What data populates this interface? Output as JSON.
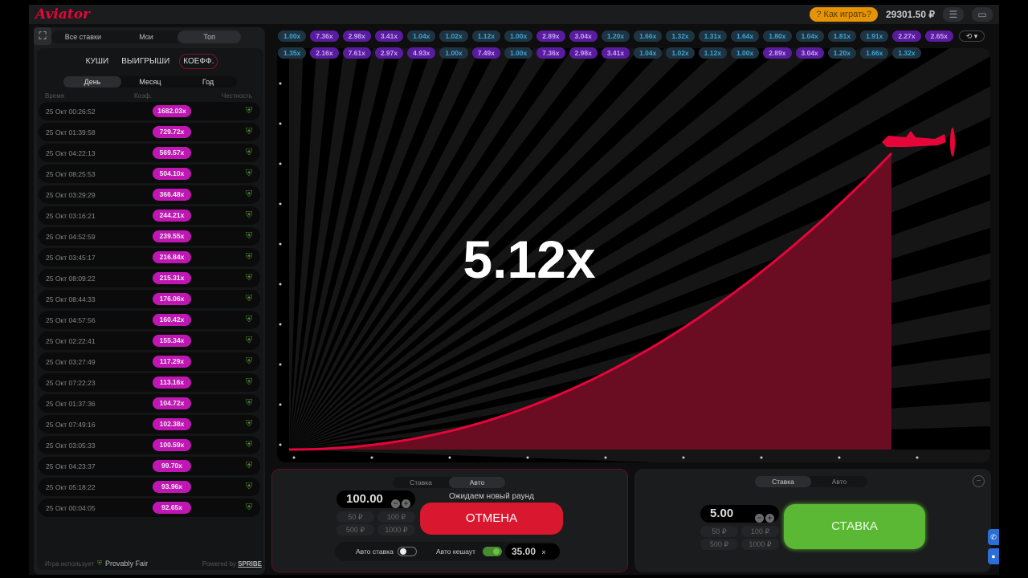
{
  "header": {
    "logo": "Aviator",
    "how_to_play": "Как играть?",
    "balance": "29301.50 ₽",
    "menu_icon": "☰",
    "chat_icon": "▭"
  },
  "left": {
    "tabs": [
      "Все ставки",
      "Мои",
      "Топ"
    ],
    "active_tab": "Топ",
    "categories": [
      "КУШИ",
      "ВЫИГРЫШИ",
      "КОЕФФ."
    ],
    "active_category": "КОЕФФ.",
    "periods": [
      "День",
      "Месяц",
      "Год"
    ],
    "active_period": "День",
    "columns": [
      "Время",
      "Коэф.",
      "Честность"
    ],
    "rows": [
      {
        "time": "25 Окт 00:26:52",
        "coef": "1682.03x"
      },
      {
        "time": "25 Окт 01:39:58",
        "coef": "729.72x"
      },
      {
        "time": "25 Окт 04:22:13",
        "coef": "569.57x"
      },
      {
        "time": "25 Окт 08:25:53",
        "coef": "504.10x"
      },
      {
        "time": "25 Окт 03:29:29",
        "coef": "366.48x"
      },
      {
        "time": "25 Окт 03:16:21",
        "coef": "244.21x"
      },
      {
        "time": "25 Окт 04:52:59",
        "coef": "239.55x"
      },
      {
        "time": "25 Окт 03:45:17",
        "coef": "216.84x"
      },
      {
        "time": "25 Окт 08:09:22",
        "coef": "215.31x"
      },
      {
        "time": "25 Окт 08:44:33",
        "coef": "176.06x"
      },
      {
        "time": "25 Окт 04:57:56",
        "coef": "160.42x"
      },
      {
        "time": "25 Окт 02:22:41",
        "coef": "155.34x"
      },
      {
        "time": "25 Окт 03:27:49",
        "coef": "117.29x"
      },
      {
        "time": "25 Окт 07:22:23",
        "coef": "113.16x"
      },
      {
        "time": "25 Окт 01:37:36",
        "coef": "104.72x"
      },
      {
        "time": "25 Окт 07:49:16",
        "coef": "102.38x"
      },
      {
        "time": "25 Окт 03:05:33",
        "coef": "100.59x"
      },
      {
        "time": "25 Окт 04:23:37",
        "coef": "99.70x"
      },
      {
        "time": "25 Окт 05:18:22",
        "coef": "93.96x"
      },
      {
        "time": "25 Окт 00:04:05",
        "coef": "92.65x"
      }
    ],
    "footer": {
      "uses": "Игра использует",
      "provably_fair": "Provably Fair",
      "powered_by": "Powered by",
      "brand": "SPRIBE"
    }
  },
  "history_row1": [
    "1.00x",
    "7.36x",
    "2.98x",
    "3.41x",
    "1.04x",
    "1.02x",
    "1.12x",
    "1.00x",
    "2.89x",
    "3.04x",
    "1.20x",
    "1.66x",
    "1.32x",
    "1.31x",
    "1.64x",
    "1.80x",
    "1.04x",
    "1.81x",
    "1.91x",
    "2.27x",
    "2.65x"
  ],
  "history_row2": [
    "1.35x",
    "2.16x",
    "7.61x",
    "2.97x",
    "4.93x",
    "1.00x",
    "7.49x",
    "1.00x",
    "7.36x",
    "2.98x",
    "3.41x",
    "1.04x",
    "1.02x",
    "1.12x",
    "1.00x",
    "2.89x",
    "3.04x",
    "1.20x",
    "1.66x",
    "1.32x"
  ],
  "game": {
    "multiplier": "5.12x"
  },
  "bet1": {
    "tabs": [
      "Ставка",
      "Авто"
    ],
    "active_tab": "Авто",
    "amount": "100.00",
    "quick": [
      "50 ₽",
      "100 ₽",
      "500 ₽",
      "1000 ₽"
    ],
    "waiting": "Ожидаем новый раунд",
    "button": "ОТМЕНА",
    "auto_bet_label": "Авто ставка",
    "auto_bet_on": false,
    "auto_cashout_label": "Авто кешаут",
    "auto_cashout_on": true,
    "cashout_value": "35.00",
    "clear": "×"
  },
  "bet2": {
    "tabs": [
      "Ставка",
      "Авто"
    ],
    "active_tab": "Ставка",
    "amount": "5.00",
    "quick": [
      "50 ₽",
      "100 ₽",
      "500 ₽",
      "1000 ₽"
    ],
    "button": "СТАВКА"
  },
  "colors": {
    "accent": "#e50539",
    "bet_green": "#5bb834",
    "cancel_red": "#d9172f",
    "top_coef": "#c017b4"
  }
}
